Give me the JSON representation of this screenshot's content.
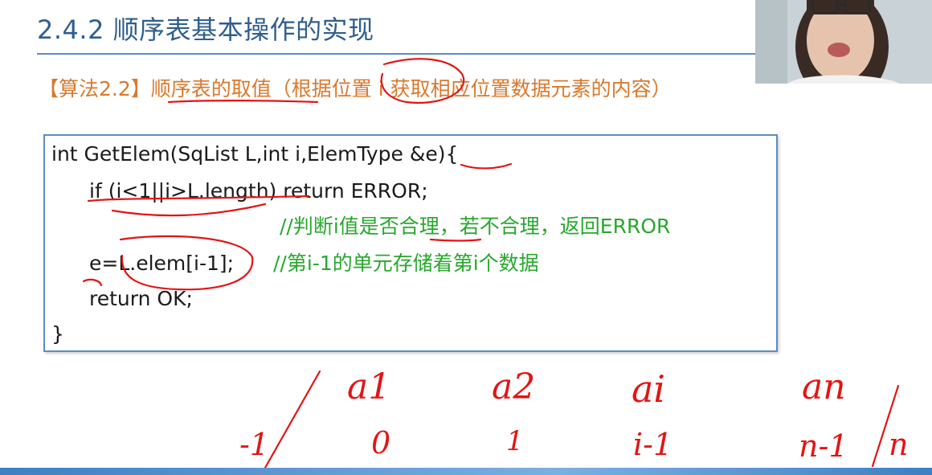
{
  "slide": {
    "title": "2.4.2 顺序表基本操作的实现"
  },
  "algorithm": {
    "tag": "【算法2.2】",
    "heading": "顺序表的取值（根据位置 i 获取相应位置数据元素的内容）"
  },
  "code": {
    "lines": [
      "int GetElem(SqList L,int i,ElemType &e){",
      "if (i<1||i>L.length) return ERROR;",
      "e=L.elem[i-1];",
      "return OK;",
      "}"
    ],
    "comments": [
      "//判断i值是否合理，若不合理，返回ERROR",
      "//第i-1的单元存储着第i个数据"
    ]
  },
  "handwriting": {
    "elements": [
      "a1",
      "a2",
      "ai",
      "an"
    ],
    "indices": [
      "-1",
      "0",
      "1",
      "i-1",
      "n-1",
      "n"
    ]
  },
  "colors": {
    "title": "#2f5e8e",
    "heading": "#d9782c",
    "comment": "#27a82d",
    "ink": "#e31414",
    "frame": "#5b8dc4"
  }
}
